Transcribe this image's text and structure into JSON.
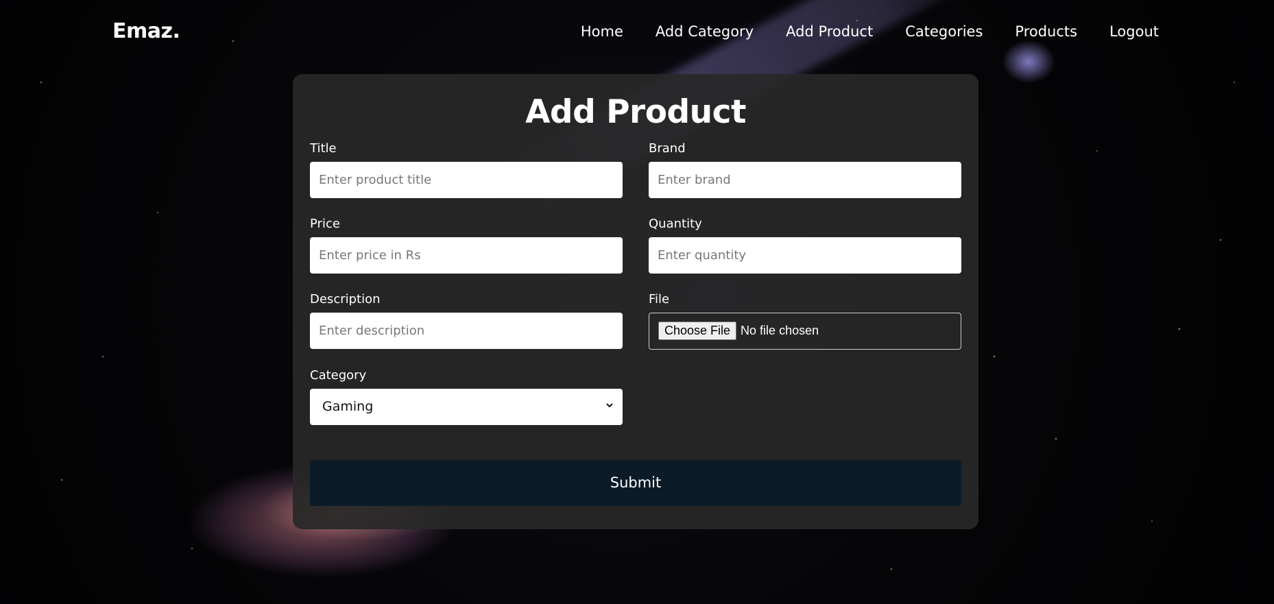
{
  "brand": {
    "logo": "Emaz."
  },
  "nav": {
    "items": [
      {
        "label": "Home"
      },
      {
        "label": "Add Category"
      },
      {
        "label": "Add Product"
      },
      {
        "label": "Categories"
      },
      {
        "label": "Products"
      },
      {
        "label": "Logout"
      }
    ]
  },
  "form": {
    "heading": "Add Product",
    "title": {
      "label": "Title",
      "placeholder": "Enter product title",
      "value": ""
    },
    "brand": {
      "label": "Brand",
      "placeholder": "Enter brand",
      "value": ""
    },
    "price": {
      "label": "Price",
      "placeholder": "Enter price in Rs",
      "value": ""
    },
    "quantity": {
      "label": "Quantity",
      "placeholder": "Enter quantity",
      "value": ""
    },
    "description": {
      "label": "Description",
      "placeholder": "Enter description",
      "value": ""
    },
    "file": {
      "label": "File",
      "button_label": "Choose File",
      "status": "No file chosen"
    },
    "category": {
      "label": "Category",
      "selected": "Gaming"
    },
    "submit_label": "Submit"
  },
  "icons": {
    "select_arrow": "chevron-down-icon"
  },
  "colors": {
    "submit_bg": "#0b1b27",
    "card_bg": "#282828",
    "text": "#ffffff"
  }
}
